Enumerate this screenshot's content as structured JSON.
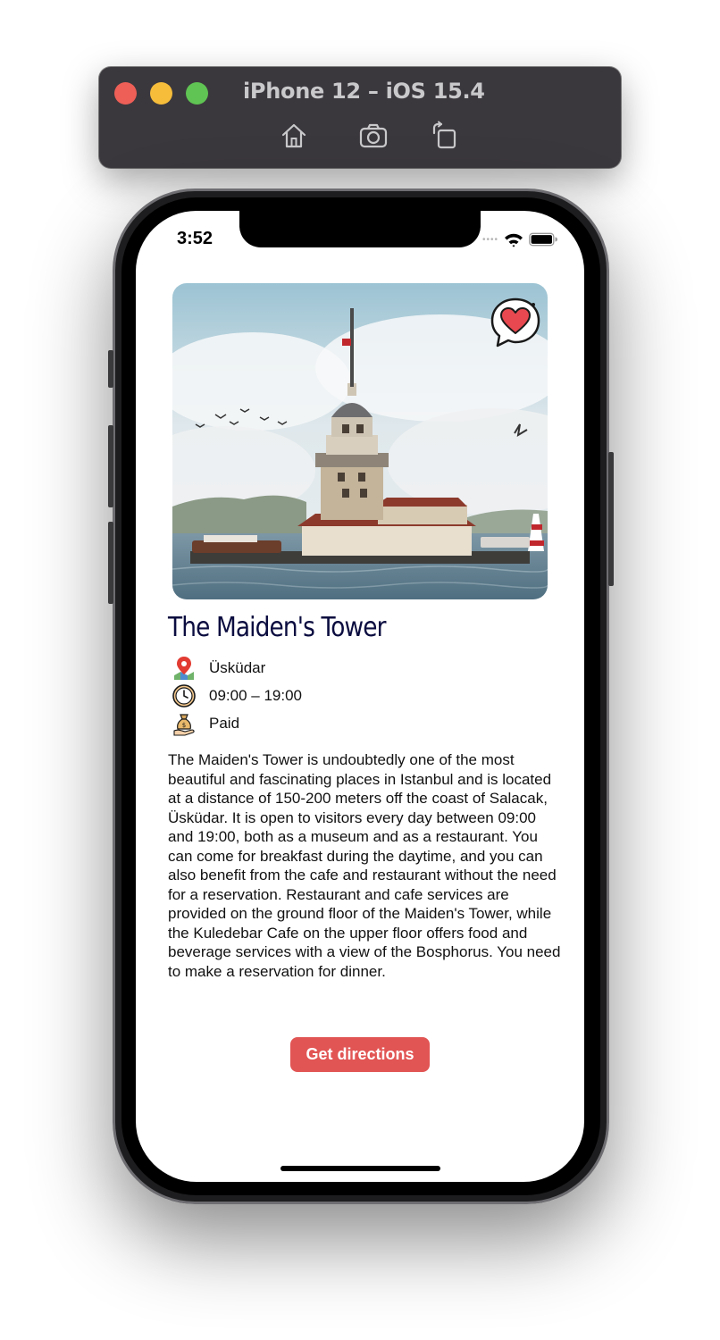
{
  "simulator": {
    "title": "iPhone 12 – iOS 15.4",
    "buttons": [
      "home-icon",
      "screenshot-camera-icon",
      "rotate-icon"
    ]
  },
  "status_bar": {
    "time": "3:52"
  },
  "place": {
    "image_alt": "The Maiden's Tower",
    "title": "The Maiden's Tower",
    "location": "Üsküdar",
    "hours": "09:00 – 19:00",
    "fee": "Paid",
    "description": "The Maiden's Tower is undoubtedly one of the most beautiful and fascinating places in Istanbul and is located at a distance of 150-200 meters off the coast of Salacak, Üsküdar. It is open to visitors every day between 09:00 and 19:00, both as a museum and as a restaurant. You can come for breakfast during the daytime, and you can also benefit from the cafe and restaurant without the need for a reservation. Restaurant and cafe services are provided on the ground floor of the Maiden's Tower, while the Kuledebar Cafe on the upper floor offers food and beverage services with a view of the Bosphorus. You need to make a reservation for dinner.",
    "directions_label": "Get directions"
  },
  "colors": {
    "accent": "#e15554",
    "title": "#0b0c3f",
    "sim_bar": "#3b383d"
  }
}
